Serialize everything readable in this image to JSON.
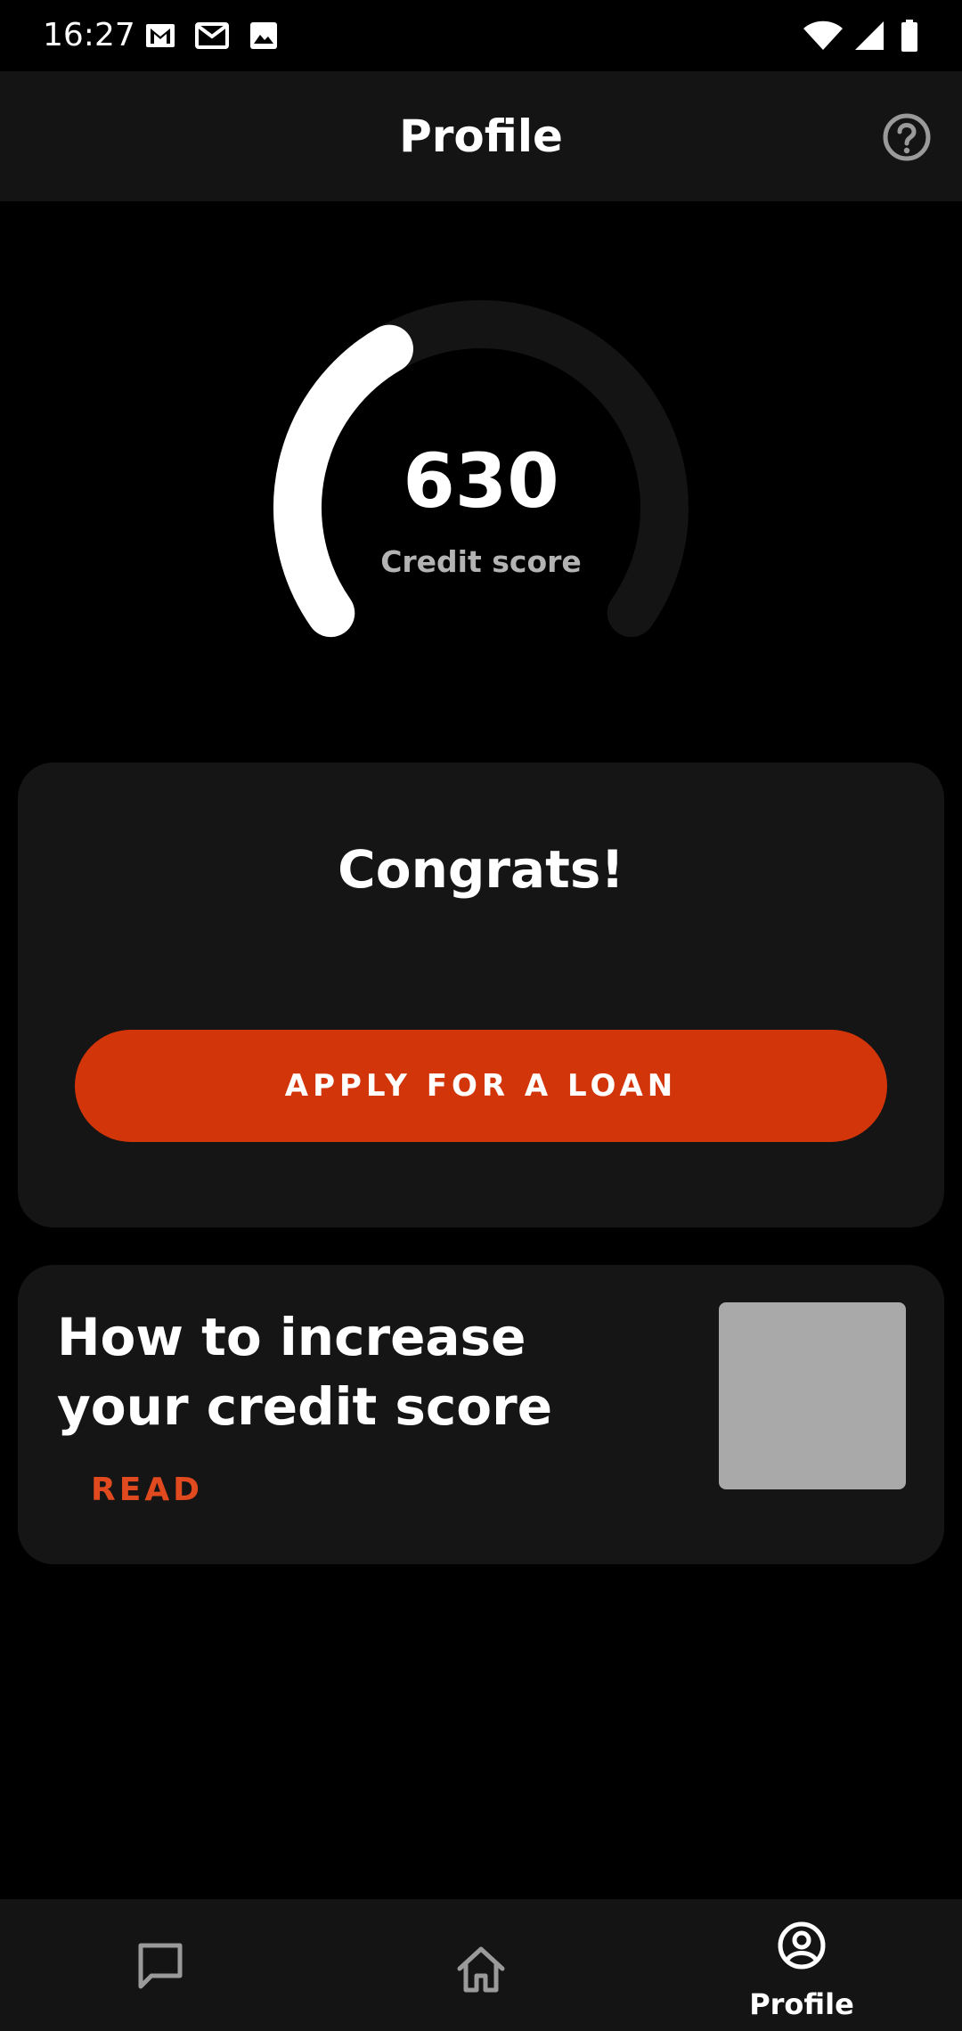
{
  "status_bar": {
    "time": "16:27",
    "icons": [
      "gmail-icon",
      "email-icon",
      "image-icon",
      "wifi-icon",
      "signal-icon",
      "battery-icon"
    ]
  },
  "app_bar": {
    "title": "Profile",
    "help_icon": "help-circle-icon"
  },
  "credit": {
    "score": "630",
    "label": "Credit score",
    "gauge_fraction": 0.38
  },
  "congrats_card": {
    "title": "Congrats!",
    "button_label": "APPLY FOR A LOAN"
  },
  "article_card": {
    "title": "How to increase your credit score",
    "link_label": "READ"
  },
  "bottom_nav": {
    "items": [
      {
        "icon": "chat-icon",
        "label": ""
      },
      {
        "icon": "home-icon",
        "label": ""
      },
      {
        "icon": "profile-icon",
        "label": "Profile"
      }
    ]
  },
  "colors": {
    "accent": "#d3350a",
    "link": "#e04a1e",
    "surface": "#151515",
    "background": "#000000"
  }
}
